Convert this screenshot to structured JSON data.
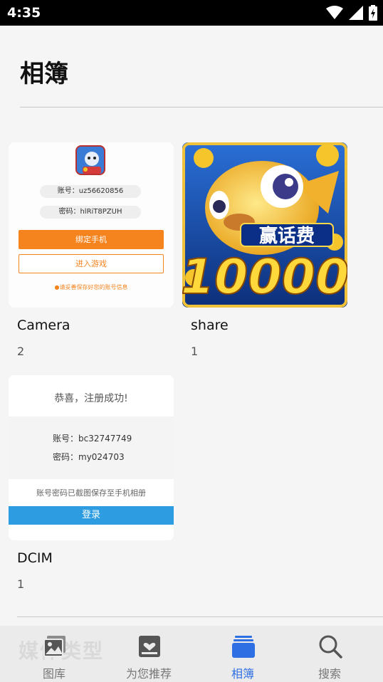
{
  "status_bar": {
    "time": "4:35"
  },
  "page": {
    "title": "相簿"
  },
  "albums": [
    {
      "name": "Camera",
      "count": "2",
      "thumbnail": {
        "account": "账号：uz56620856",
        "password": "密码：hlRiT8PZUH",
        "bind_button": "绑定手机",
        "enter_button": "进入游戏",
        "tip": "请妥善保存好您的账号信息"
      }
    },
    {
      "name": "share",
      "count": "1",
      "thumbnail": {
        "banner_text": "赢话费",
        "big_number": "10000"
      }
    },
    {
      "name": "DCIM",
      "count": "1",
      "thumbnail": {
        "heading": "恭喜，注册成功!",
        "account": "账号：bc32747749",
        "password": "密码：my024703",
        "note": "账号密码已截图保存至手机相册",
        "login_button": "登录"
      }
    }
  ],
  "tab_bar": {
    "ghost_text": "媒体类型",
    "tabs": [
      {
        "label": "图库",
        "icon": "gallery-icon",
        "active": false
      },
      {
        "label": "为您推荐",
        "icon": "recommend-icon",
        "active": false
      },
      {
        "label": "相簿",
        "icon": "albums-icon",
        "active": true
      },
      {
        "label": "搜索",
        "icon": "search-icon",
        "active": false
      }
    ]
  },
  "colors": {
    "accent": "#2f6fe4",
    "orange": "#f5841f",
    "login_blue": "#2e9ce0"
  }
}
